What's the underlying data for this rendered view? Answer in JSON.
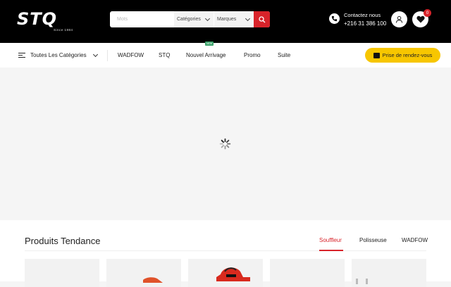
{
  "header": {
    "logo_text": "STQ",
    "logo_since": "Since 1984",
    "search_placeholder": "Mots",
    "categories_select": "Catégories",
    "brands_select": "Marques",
    "contact_label": "Contactez nous",
    "contact_phone": "+216 31 386 100",
    "wishlist_count": "0"
  },
  "nav": {
    "all_categories": "Toutes Les Catégories",
    "links": [
      "WADFOW",
      "STQ",
      "Nouvel Arrivage",
      "Promo",
      "Suite"
    ],
    "new_tag": "NEW",
    "appointment_button": "Prise de rendez-vous"
  },
  "products": {
    "title": "Produits Tendance",
    "tabs": [
      "Souffleur",
      "Polisseuse",
      "WADFOW"
    ],
    "active_tab": "Souffleur"
  },
  "colors": {
    "accent": "#d8232a",
    "cta": "#f7c600",
    "topbar": "#000000"
  },
  "icons": [
    "search-icon",
    "phone-icon",
    "user-icon",
    "heart-icon",
    "menu-icon",
    "calendar-icon",
    "loading-spinner-icon"
  ]
}
